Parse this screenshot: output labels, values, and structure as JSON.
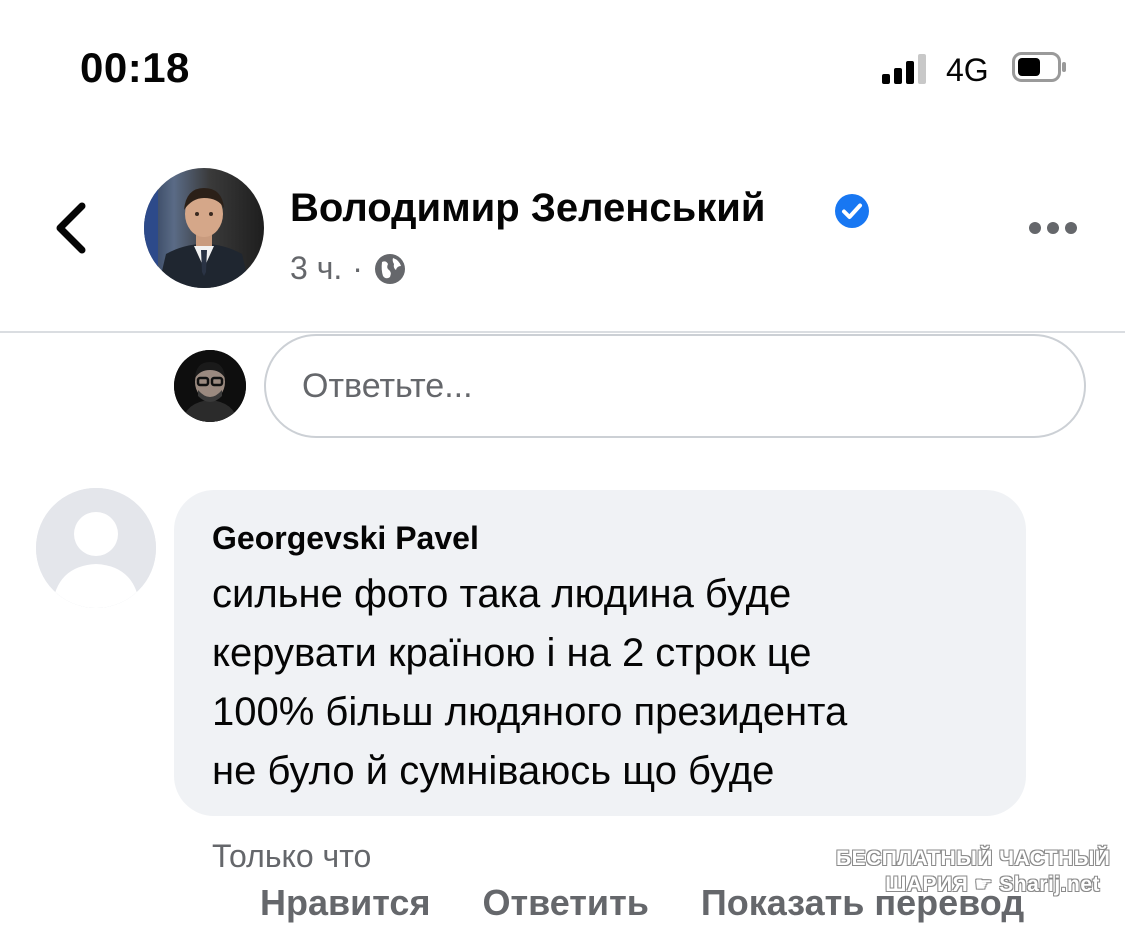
{
  "status_bar": {
    "time": "00:18",
    "network": "4G",
    "signal_bars_active": 3,
    "signal_bars_total": 4,
    "battery_level": 0.55
  },
  "post": {
    "author": "Володимир Зеленський",
    "verified": true,
    "time": "3 ч.",
    "separator": "·",
    "audience_icon": "globe-icon",
    "more_icon": "more-horizontal-icon",
    "back_icon": "chevron-left-icon"
  },
  "composer": {
    "placeholder": "Ответьте..."
  },
  "comment": {
    "author": "Georgevski Pavel",
    "lines": [
      "сильне фото така людина буде",
      "керувати країною і на 2 строк це",
      "100% більш людяного президента",
      "не було й сумніваюсь що буде"
    ],
    "time": "Только что",
    "actions": {
      "like": "Нравится",
      "reply": "Ответить",
      "translate": "Показать перевод"
    }
  },
  "watermark": {
    "line1": "БЕСПЛАТНЫЙ ЧАСТНЫЙ",
    "line2_a": "ШАРИЯ",
    "line2_b": "Sharij.net"
  },
  "colors": {
    "verified_blue": "#1877f2",
    "secondary_text": "#65676b",
    "bubble_bg": "#f0f2f5",
    "divider": "#dadde1"
  }
}
